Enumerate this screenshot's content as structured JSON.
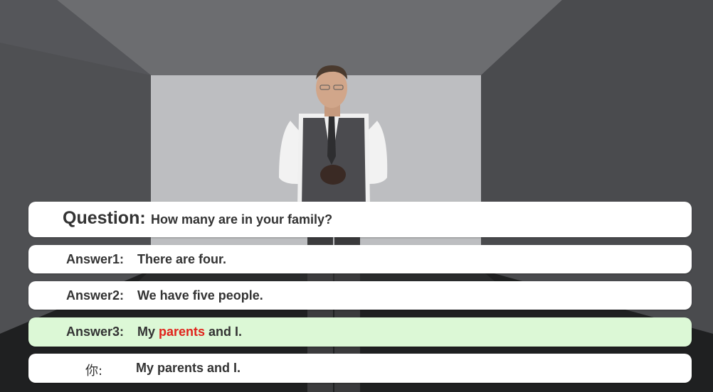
{
  "question": {
    "label": "Question:",
    "text": "How many are in your family?"
  },
  "answers": [
    {
      "label": "Answer1:",
      "text": "There are four.",
      "selected": false
    },
    {
      "label": "Answer2:",
      "text": "We have five people.",
      "selected": false
    },
    {
      "label": "Answer3:",
      "text_before": "My ",
      "text_highlight": "parents",
      "text_after": " and I.",
      "selected": true
    }
  ],
  "user_input": {
    "label": "你:",
    "text": "My parents and I."
  },
  "colors": {
    "selected_answer_bg": "#dcf8d6",
    "highlight_word": "#e0231b",
    "panel_bg": "#ffffff"
  }
}
